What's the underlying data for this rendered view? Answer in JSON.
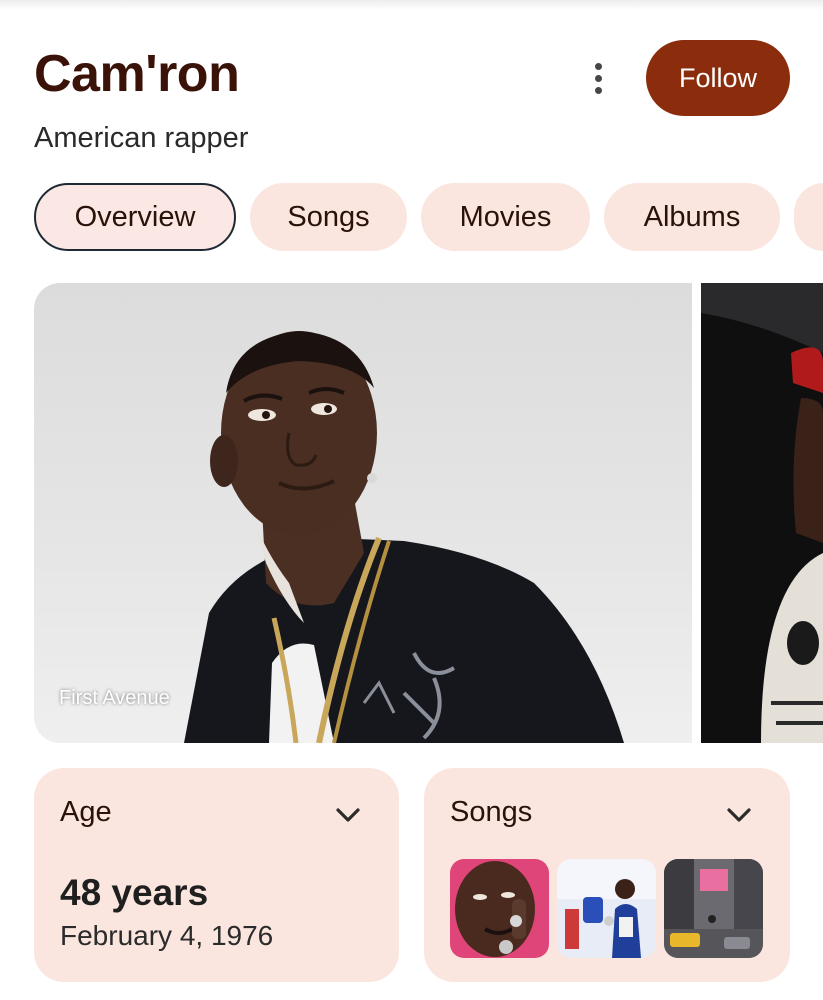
{
  "header": {
    "title": "Cam'ron",
    "subtitle": "American rapper",
    "follow_label": "Follow",
    "more_icon": "more-vert-icon"
  },
  "tabs": [
    {
      "label": "Overview",
      "active": true
    },
    {
      "label": "Songs",
      "active": false
    },
    {
      "label": "Movies",
      "active": false
    },
    {
      "label": "Albums",
      "active": false
    },
    {
      "label": "",
      "active": false
    }
  ],
  "photos": {
    "credit": "First Avenue"
  },
  "cards": {
    "age": {
      "label": "Age",
      "value": "48 years",
      "date": "February 4, 1976",
      "icon": "chevron-down-icon"
    },
    "songs": {
      "label": "Songs",
      "icon": "chevron-down-icon",
      "thumbnails": [
        "song-thumbnail-1",
        "song-thumbnail-2",
        "song-thumbnail-3"
      ]
    }
  },
  "colors": {
    "title": "#3b1208",
    "follow_bg": "#8b2c0c",
    "chip_bg": "#fbe5df",
    "card_bg": "#fbe5df"
  }
}
